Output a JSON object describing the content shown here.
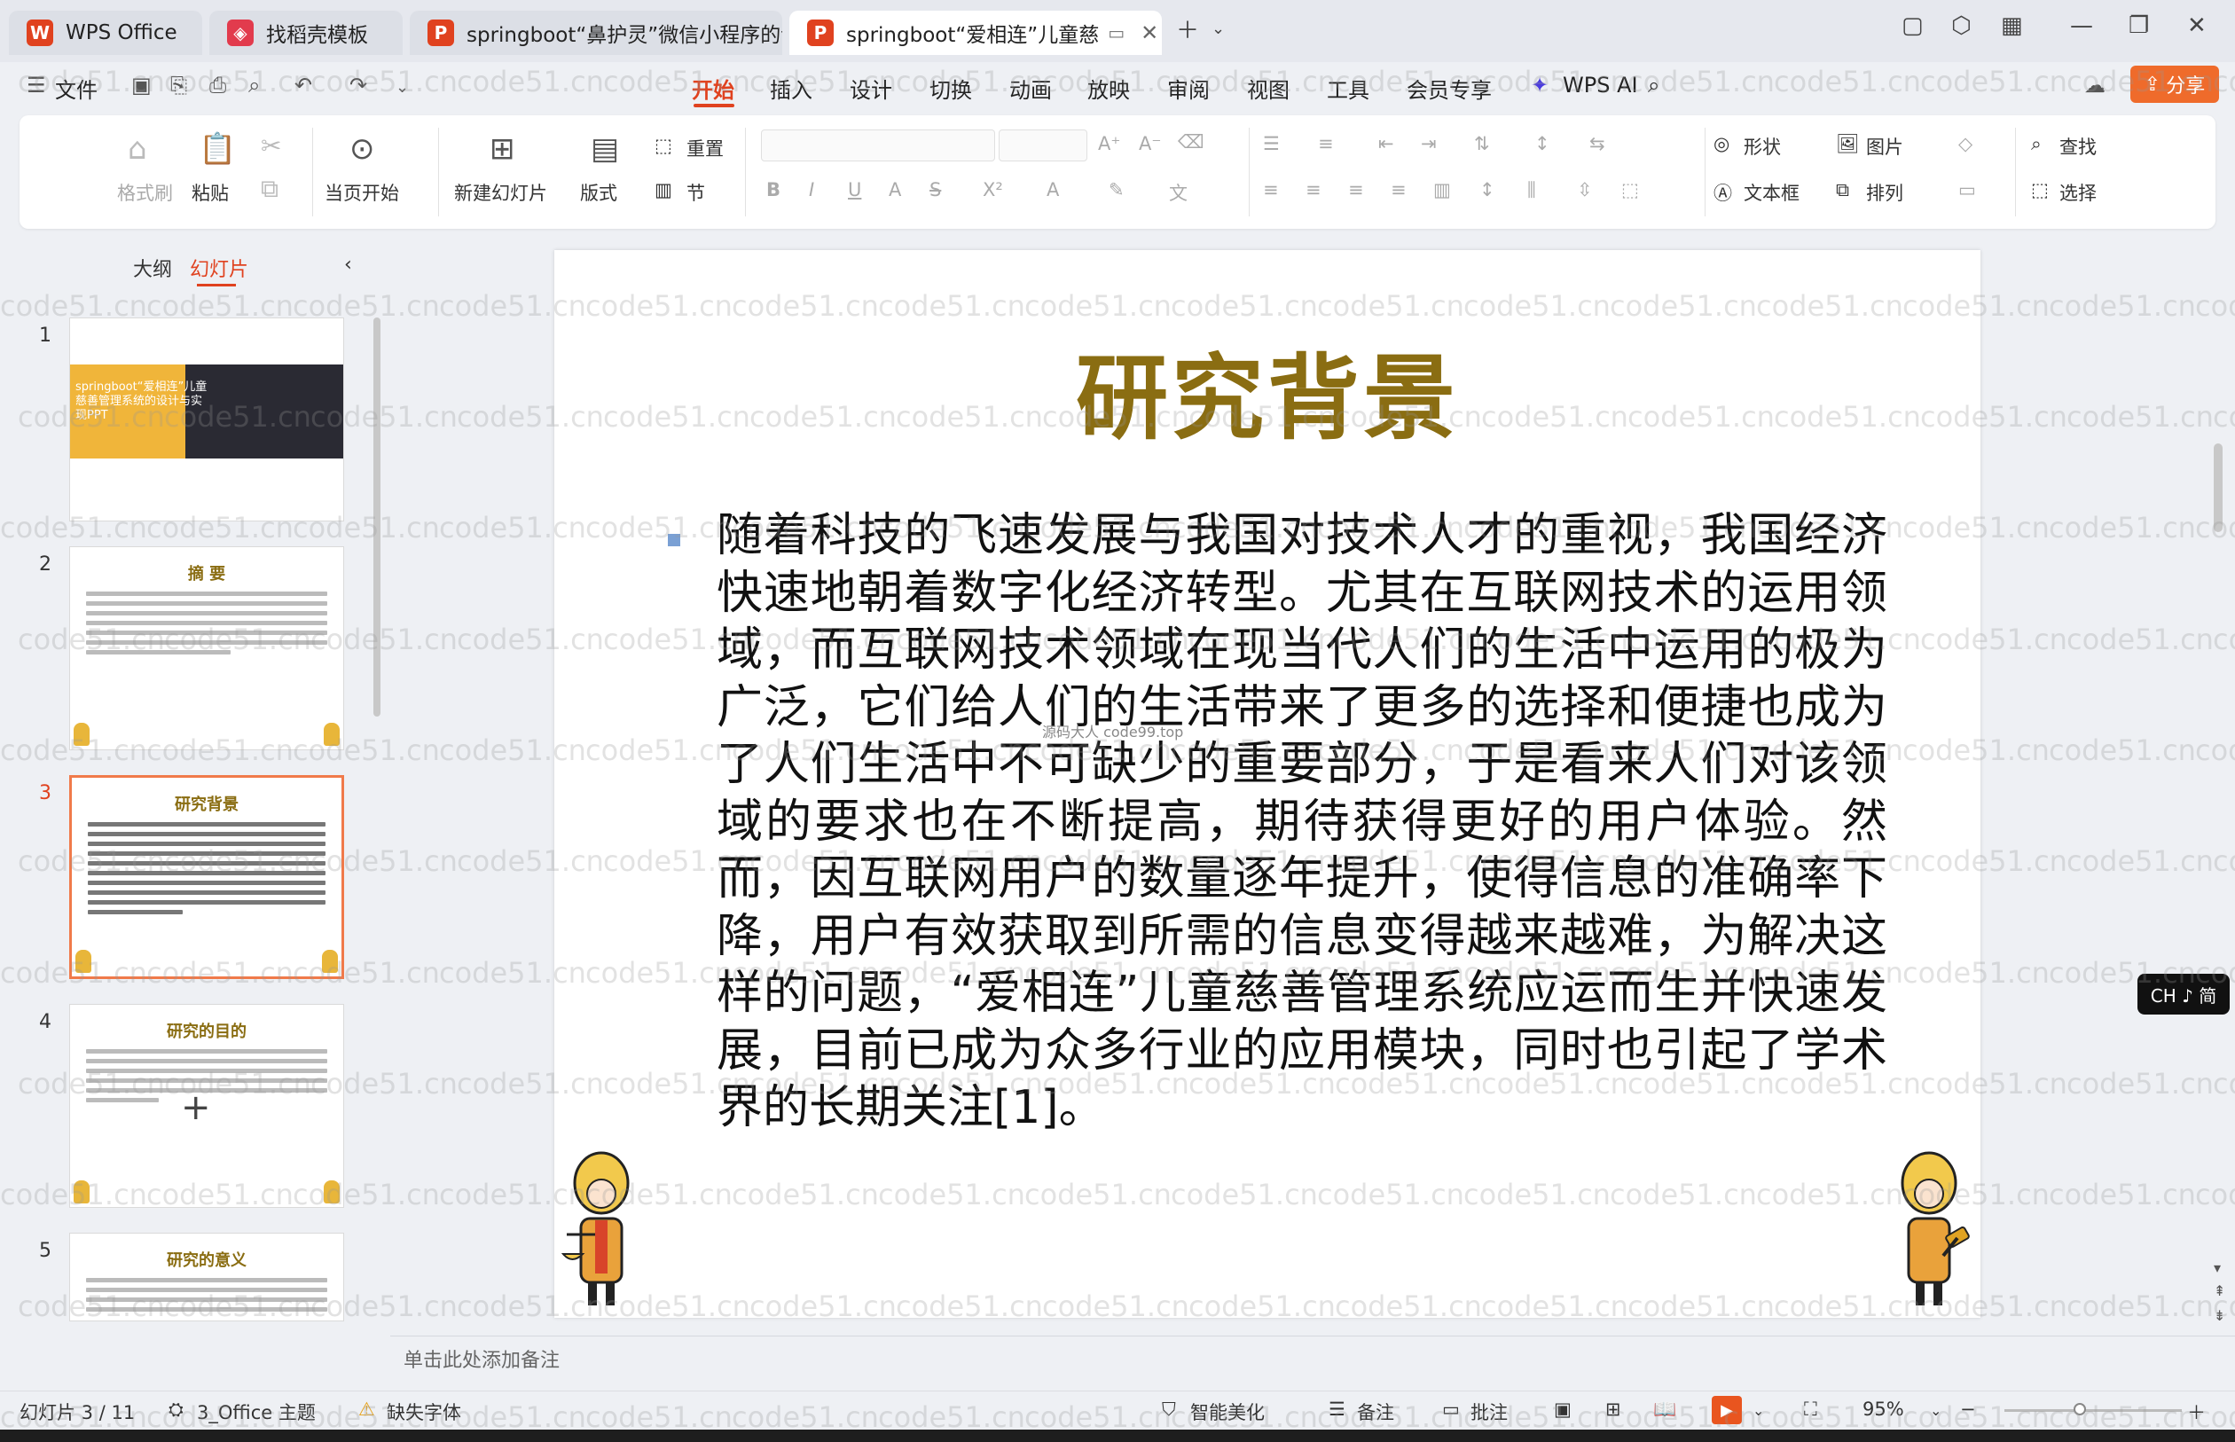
{
  "tabs": [
    {
      "label": "WPS Office",
      "icon": "wps-logo-icon",
      "active": false
    },
    {
      "label": "找稻壳模板",
      "icon": "docer-icon",
      "active": false
    },
    {
      "label": "springboot“鼻护灵”微信小程序的设",
      "icon": "ppt-icon",
      "active": false
    },
    {
      "label": "springboot“爱相连”儿童慈",
      "icon": "ppt-icon",
      "active": true
    }
  ],
  "menu": {
    "file": "文件",
    "items": [
      "开始",
      "插入",
      "设计",
      "切换",
      "动画",
      "放映",
      "审阅",
      "视图",
      "工具",
      "会员专享",
      "WPS AI"
    ],
    "active": "开始",
    "share": "分享"
  },
  "ribbon": {
    "format_painter": "格式刷",
    "paste": "粘贴",
    "start_from_current": "当页开始",
    "new_slide": "新建幻灯片",
    "layout": "版式",
    "reset": "重置",
    "section": "节",
    "shape": "形状",
    "picture": "图片",
    "find": "查找",
    "textbox": "文本框",
    "arrange": "排列",
    "select": "选择"
  },
  "left_panel": {
    "tab_outline": "大纲",
    "tab_slides": "幻灯片",
    "thumbnails": [
      {
        "num": "1",
        "title": "springboot“爱相连”儿童慈善管理系统的设计与实现PPT"
      },
      {
        "num": "2",
        "title": "摘 要"
      },
      {
        "num": "3",
        "title": "研究背景"
      },
      {
        "num": "4",
        "title": "研究的目的"
      },
      {
        "num": "5",
        "title": "研究的意义"
      }
    ],
    "add_button": "+"
  },
  "slide": {
    "title": "研究背景",
    "body": "随着科技的飞速发展与我国对技术人才的重视，我国经济快速地朝着数字化经济转型。尤其在互联网技术的运用领域，而互联网技术领域在现当代人们的生活中运用的极为广泛，它们给人们的生活带来了更多的选择和便捷也成为了人们生活中不可缺少的重要部分，于是看来人们对该领域的要求也在不断提高，期待获得更好的用户体验。然而，因互联网用户的数量逐年提升，使得信息的准确率下降，用户有效获取到所需的信息变得越来越难，为解决这样的问题，“爱相连”儿童慈善管理系统应运而生并快速发展，目前已成为众多行业的应用模块，同时也引起了学术界的长期关注[1]。",
    "small_mark": "源码大人 code99.top"
  },
  "notes_placeholder": "单击此处添加备注",
  "ime_label": "CH ♪ 简",
  "status": {
    "slide_counter": "幻灯片 3 / 11",
    "theme": "3_Office 主题",
    "missing_font": "缺失字体",
    "smart_beautify": "智能美化",
    "notes": "备注",
    "comments": "批注",
    "zoom": "95%"
  },
  "watermark": "code51.cn",
  "colors": {
    "accent": "#e0421f",
    "title_gold": "#8a6d12",
    "share_orange": "#ef6b2b"
  }
}
